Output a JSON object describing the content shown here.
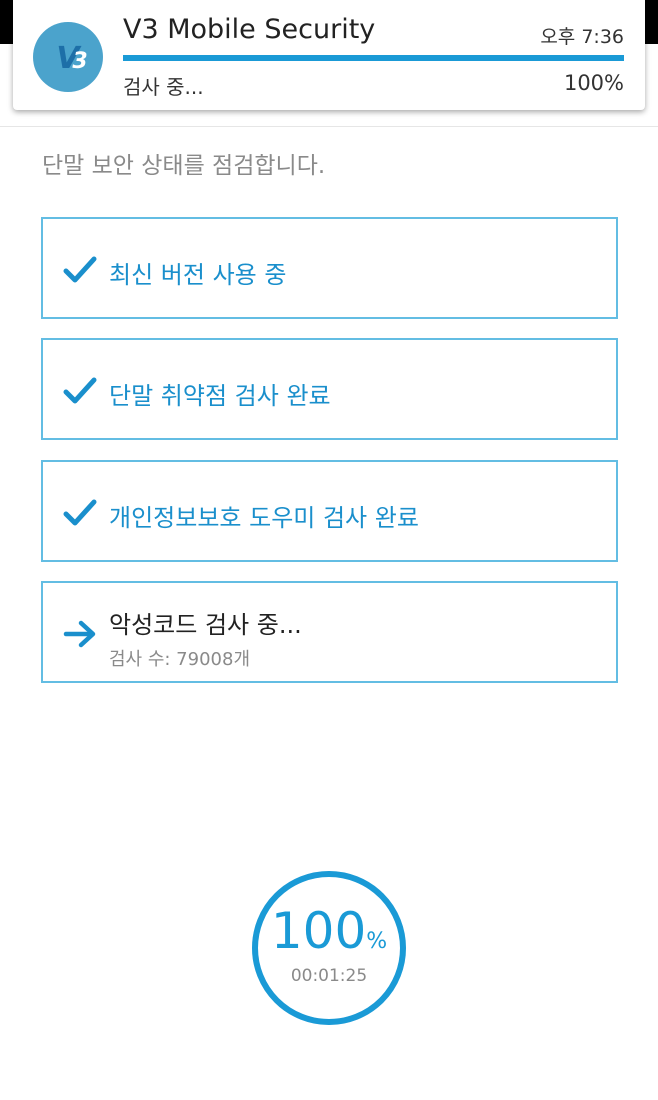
{
  "notification": {
    "app_icon": "v3-logo-icon",
    "title": "V3 Mobile Security",
    "time": "오후 7:36",
    "progress": 1.0,
    "status": "검사 중...",
    "percent": "100%"
  },
  "page": {
    "title": "단말 보안 상태를 점검합니다."
  },
  "checks": [
    {
      "icon": "check-icon",
      "label": "최신 버전 사용 중",
      "state": "done"
    },
    {
      "icon": "check-icon",
      "label": "단말 취약점 검사 완료",
      "state": "done"
    },
    {
      "icon": "check-icon",
      "label": "개인정보보호 도우미 검사 완료",
      "state": "done"
    },
    {
      "icon": "arrow-right-icon",
      "label": "악성코드 검사 중...",
      "sub": "검사 수: 79008개",
      "state": "in-progress"
    }
  ],
  "scan_progress": {
    "value": "100",
    "unit": "%",
    "fraction": 1.0,
    "elapsed": "00:01:25"
  },
  "colors": {
    "accent": "#1a9ad6",
    "card_border": "#63bde3",
    "check_text": "#1a8fcc",
    "muted_text": "#8a8a8a"
  }
}
